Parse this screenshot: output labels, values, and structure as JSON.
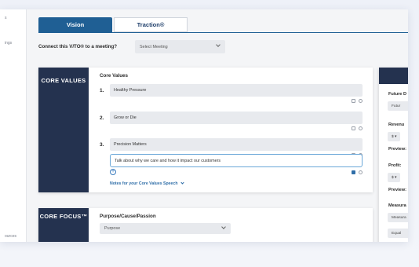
{
  "sidebar": {
    "items": [
      "s",
      "ings",
      "ources"
    ]
  },
  "tabs": [
    {
      "label": "Vision"
    },
    {
      "label": "Traction®"
    }
  ],
  "connect": {
    "label": "Connect this V/TO® to a meeting?",
    "select_value": "Select Meeting"
  },
  "core_values": {
    "section_title": "CORE VALUES",
    "heading": "Core Values",
    "items": [
      {
        "num": "1.",
        "value": "Healthy Pressure"
      },
      {
        "num": "2.",
        "value": "Grow or Die"
      },
      {
        "num": "3.",
        "value": "Precision Matters"
      }
    ],
    "speech_text": "Talk about why we care and how it impact our customers",
    "add_symbol": "+",
    "notes_link": "Notes for your Core Values Speech"
  },
  "core_focus": {
    "section_title": "CORE FOCUS™",
    "heading": "Purpose/Cause/Passion",
    "select_value": "Purpose"
  },
  "right_panel": {
    "future_date_label": "Future D",
    "future_field": "Futur",
    "revenue_label": "Revenu",
    "revenue_currency": "$ ▾",
    "preview1": "Preview:",
    "profit_label": "Profit:",
    "profit_currency": "$ ▾",
    "preview2": "Preview:",
    "measurable_label": "Measura",
    "measurable_field": "Measura",
    "equal_field": "Equal"
  },
  "colors": {
    "primary": "#1f5f94",
    "navy": "#24324f",
    "link": "#2f6ea8"
  }
}
